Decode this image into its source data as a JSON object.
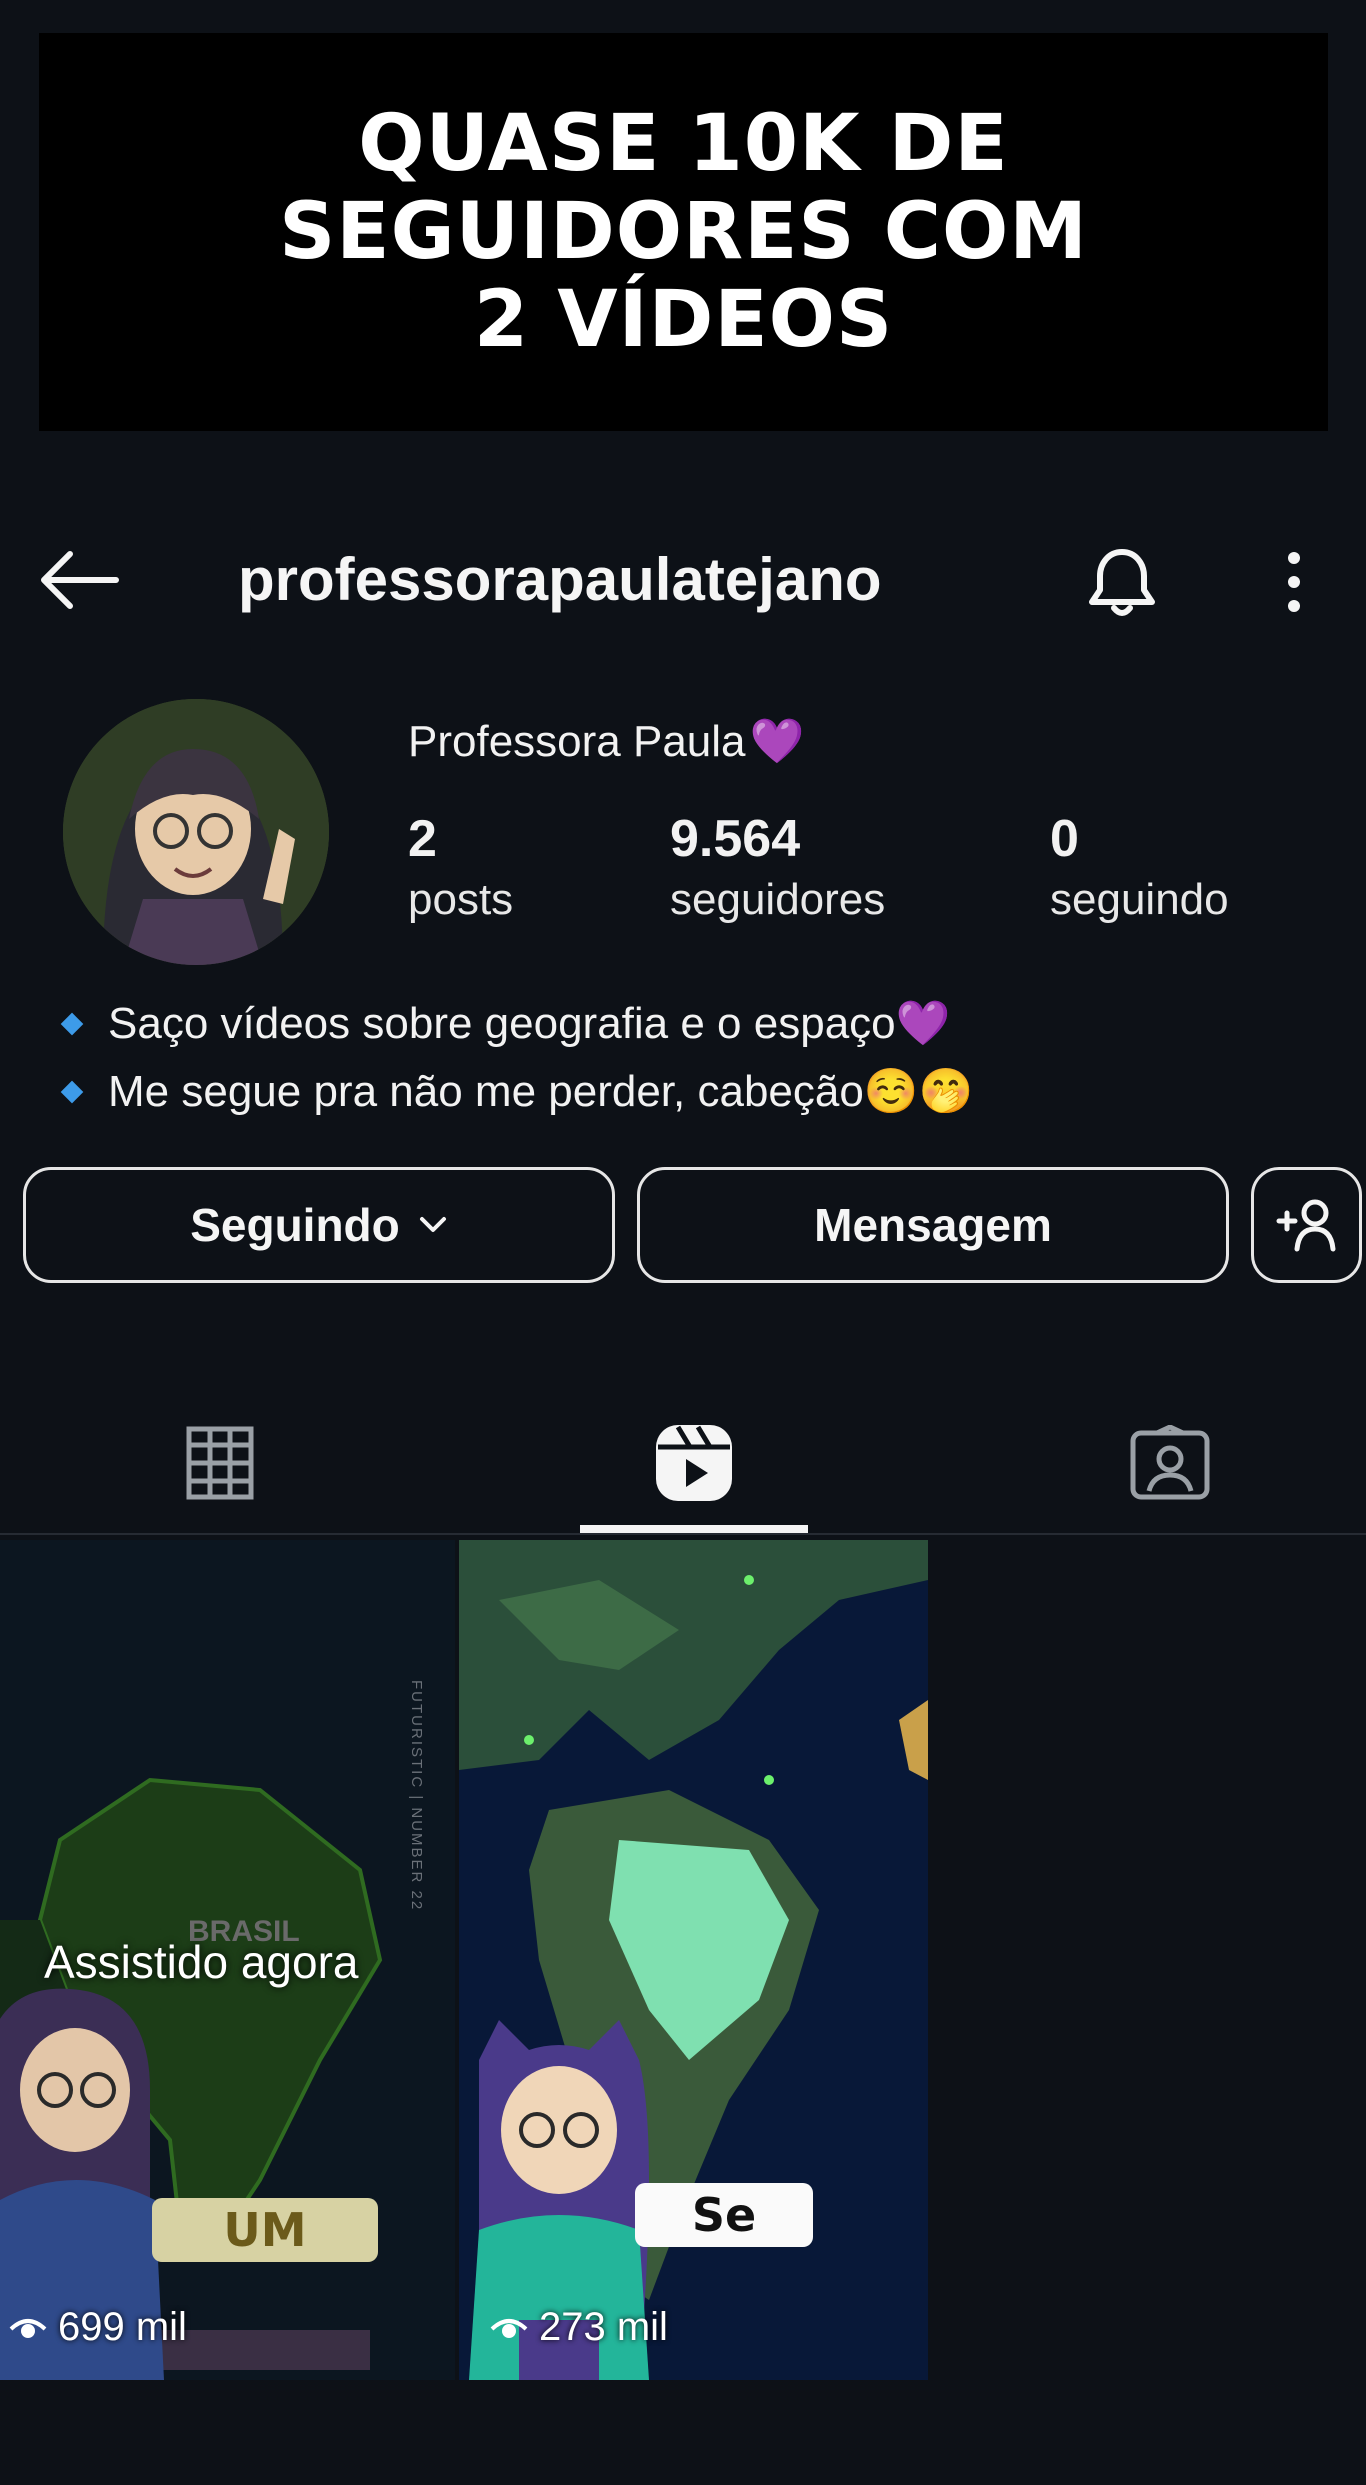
{
  "banner": {
    "text": "QUASE 10K DE\nSEGUIDORES COM\n2 VÍDEOS"
  },
  "header": {
    "username": "professorapaulatejano"
  },
  "profile": {
    "display_name": "Professora Paula",
    "name_emoji": "💜",
    "stats": [
      {
        "value": "2",
        "label": "posts"
      },
      {
        "value": "9.564",
        "label": "seguidores"
      },
      {
        "value": "0",
        "label": "seguindo"
      }
    ],
    "bio": [
      {
        "text": "Saço vídeos sobre geografia e o espaço",
        "emoji": "💜"
      },
      {
        "text": "Me segue pra não me perder, cabeção",
        "emoji": "☺️🤭"
      }
    ]
  },
  "actions": {
    "following_label": "Seguindo",
    "message_label": "Mensagem"
  },
  "tabs": [
    {
      "icon": "grid-icon"
    },
    {
      "icon": "reels-icon",
      "active": true
    },
    {
      "icon": "tagged-icon"
    }
  ],
  "reels": [
    {
      "views": "699 mil",
      "overlay": "Assistido agora",
      "caption": "UM",
      "map_label": "BRASIL",
      "side_text": "FUTURISTIC | NUMBER 22"
    },
    {
      "views": "273 mil",
      "caption": "Se"
    }
  ],
  "colors": {
    "background": "#0d1117",
    "banner": "#000000",
    "bullet": "#3d9be9",
    "text": "#f2f2f2"
  }
}
